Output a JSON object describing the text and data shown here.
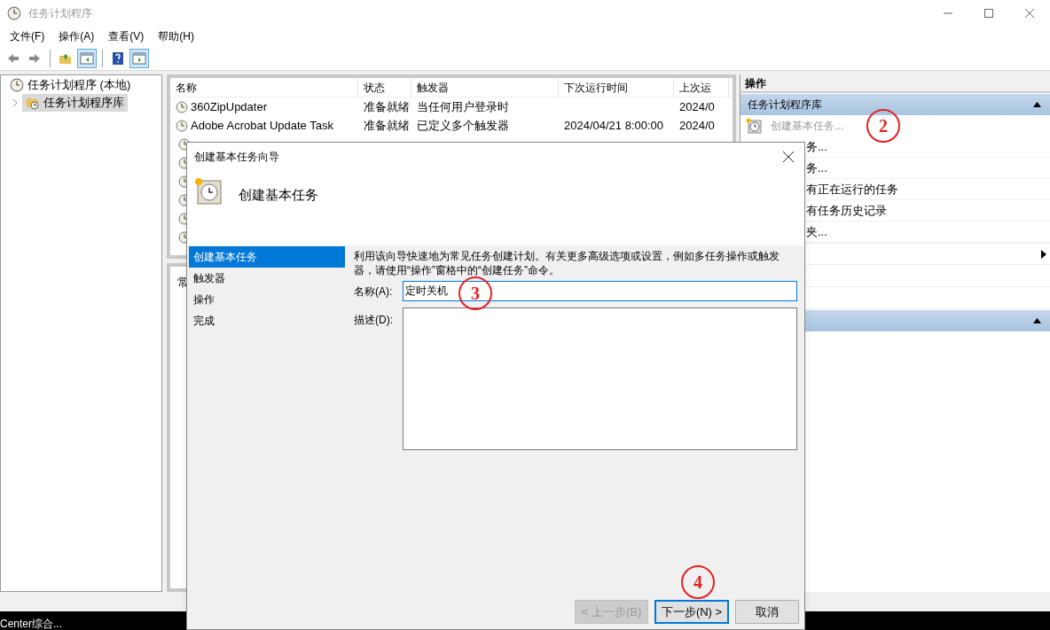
{
  "window": {
    "title": "任务计划程序"
  },
  "menu": [
    "文件(F)",
    "操作(A)",
    "查看(V)",
    "帮助(H)"
  ],
  "toolbar": [
    {
      "kind": "back",
      "pressed": false
    },
    {
      "kind": "forward",
      "pressed": false
    },
    {
      "kind": "separator"
    },
    {
      "kind": "folder",
      "pressed": false
    },
    {
      "kind": "pane-left",
      "pressed": true
    },
    {
      "kind": "separator"
    },
    {
      "kind": "help",
      "pressed": false
    },
    {
      "kind": "pane-right",
      "pressed": true
    }
  ],
  "tree": [
    {
      "label": "任务计划程序 (本地)",
      "selected": false,
      "expanded": true,
      "children": [
        {
          "label": "任务计划程序库",
          "selected": true,
          "expanded": false
        }
      ]
    }
  ],
  "table": {
    "columns": [
      "名称",
      "状态",
      "触发器",
      "下次运行时间",
      "上次运"
    ],
    "rows": [
      {
        "kind": "full",
        "cells": [
          "360ZipUpdater",
          "准备就绪",
          "当任何用户登录时",
          "",
          "2024/0"
        ]
      },
      {
        "kind": "full",
        "cells": [
          "Adobe Acrobat Update Task",
          "准备就绪",
          "已定义多个触发器",
          "2024/04/21 8:00:00",
          "2024/0"
        ]
      },
      {
        "kind": "covered",
        "cells": []
      },
      {
        "kind": "covered",
        "cells": []
      },
      {
        "kind": "covered",
        "cells": []
      },
      {
        "kind": "covered",
        "cells": []
      },
      {
        "kind": "covered",
        "cells": []
      },
      {
        "kind": "covered",
        "cells": []
      }
    ]
  },
  "details": {
    "tab": "常"
  },
  "actions": {
    "title": "操作",
    "sections": [
      {
        "title": "任务计划程序库",
        "expanded": true,
        "items": [
          {
            "kind": "icon",
            "label": "创建基本任务...",
            "disabled": true
          },
          {
            "kind": "cut",
            "label": "务...",
            "disabled": false
          },
          {
            "kind": "cut",
            "label": "务...",
            "disabled": false
          },
          {
            "kind": "cut",
            "label": "有正在运行的任务",
            "disabled": false
          },
          {
            "kind": "cut",
            "label": "有任务历史记录",
            "disabled": false
          },
          {
            "kind": "cut",
            "label": "夹...",
            "disabled": false
          },
          {
            "kind": "submenu",
            "disabled": false
          },
          {
            "kind": "blank",
            "disabled": false
          },
          {
            "kind": "blank",
            "disabled": false
          }
        ]
      },
      {
        "expanded": true
      }
    ]
  },
  "taskbar": {
    "text": "Center综合..."
  },
  "dialog": {
    "title": "创建基本任务向导",
    "heading": "创建基本任务",
    "steps": [
      {
        "label": "创建基本任务",
        "selected": true
      },
      {
        "label": "触发器",
        "selected": false
      },
      {
        "label": "操作",
        "selected": false
      },
      {
        "label": "完成",
        "selected": false
      }
    ],
    "intro": "利用该向导快速地为常见任务创建计划。有关更多高级选项或设置，例如多任务操作或触发器，请使用“操作”窗格中的“创建任务”命令。",
    "name_label": "名称(A):",
    "name_value": "定时关机",
    "description_label": "描述(D):",
    "buttons": [
      {
        "kind": "back",
        "label": "< 上一步(B)",
        "disabled": true,
        "focused": false
      },
      {
        "kind": "next",
        "label": "下一步(N) >",
        "disabled": false,
        "focused": true
      },
      {
        "kind": "cancel",
        "label": "取消",
        "disabled": false,
        "focused": false
      }
    ]
  },
  "annotations": [
    {
      "label": "2"
    },
    {
      "label": "3"
    },
    {
      "label": "4"
    }
  ]
}
